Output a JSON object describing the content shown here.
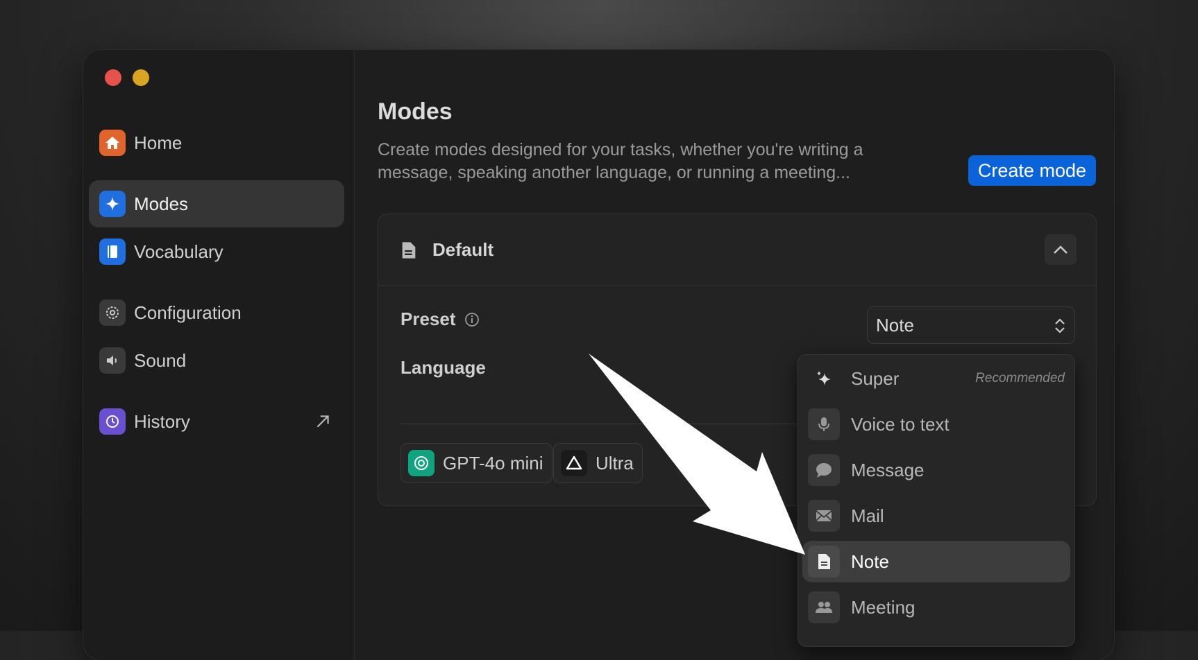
{
  "window": {
    "traffic_lights": [
      "close",
      "minimize"
    ]
  },
  "sidebar": {
    "items": [
      {
        "label": "Home",
        "icon": "house-icon",
        "color": "#e0642c",
        "active": false
      },
      {
        "label": "Modes",
        "icon": "sparkle-icon",
        "color": "#1f6fe0",
        "active": true
      },
      {
        "label": "Vocabulary",
        "icon": "book-icon",
        "color": "#1f6fe0",
        "active": false
      },
      {
        "label": "Configuration",
        "icon": "gear-icon",
        "color": "#3a3a3a",
        "active": false
      },
      {
        "label": "Sound",
        "icon": "speaker-icon",
        "color": "#3a3a3a",
        "active": false
      },
      {
        "label": "History",
        "icon": "history-icon",
        "color": "#6a4fd0",
        "active": false
      }
    ]
  },
  "main": {
    "title": "Modes",
    "description": "Create modes designed for your tasks, whether you're writing a message, speaking another language, or running a meeting...",
    "create_button": "Create mode",
    "card": {
      "title": "Default",
      "preset_label": "Preset",
      "preset_value": "Note",
      "language_label": "Language",
      "chips": [
        "GPT-4o mini",
        "Ultra"
      ]
    }
  },
  "dropdown": {
    "options": [
      {
        "label": "Super",
        "icon": "sparkles-icon",
        "badge": "Recommended"
      },
      {
        "label": "Voice to text",
        "icon": "microphone-icon"
      },
      {
        "label": "Message",
        "icon": "speech-bubble-icon"
      },
      {
        "label": "Mail",
        "icon": "envelope-icon"
      },
      {
        "label": "Note",
        "icon": "document-icon",
        "selected": true
      },
      {
        "label": "Meeting",
        "icon": "people-icon"
      }
    ]
  },
  "colors": {
    "accent": "#0a63d8",
    "window_bg": "#1e1e1e"
  }
}
